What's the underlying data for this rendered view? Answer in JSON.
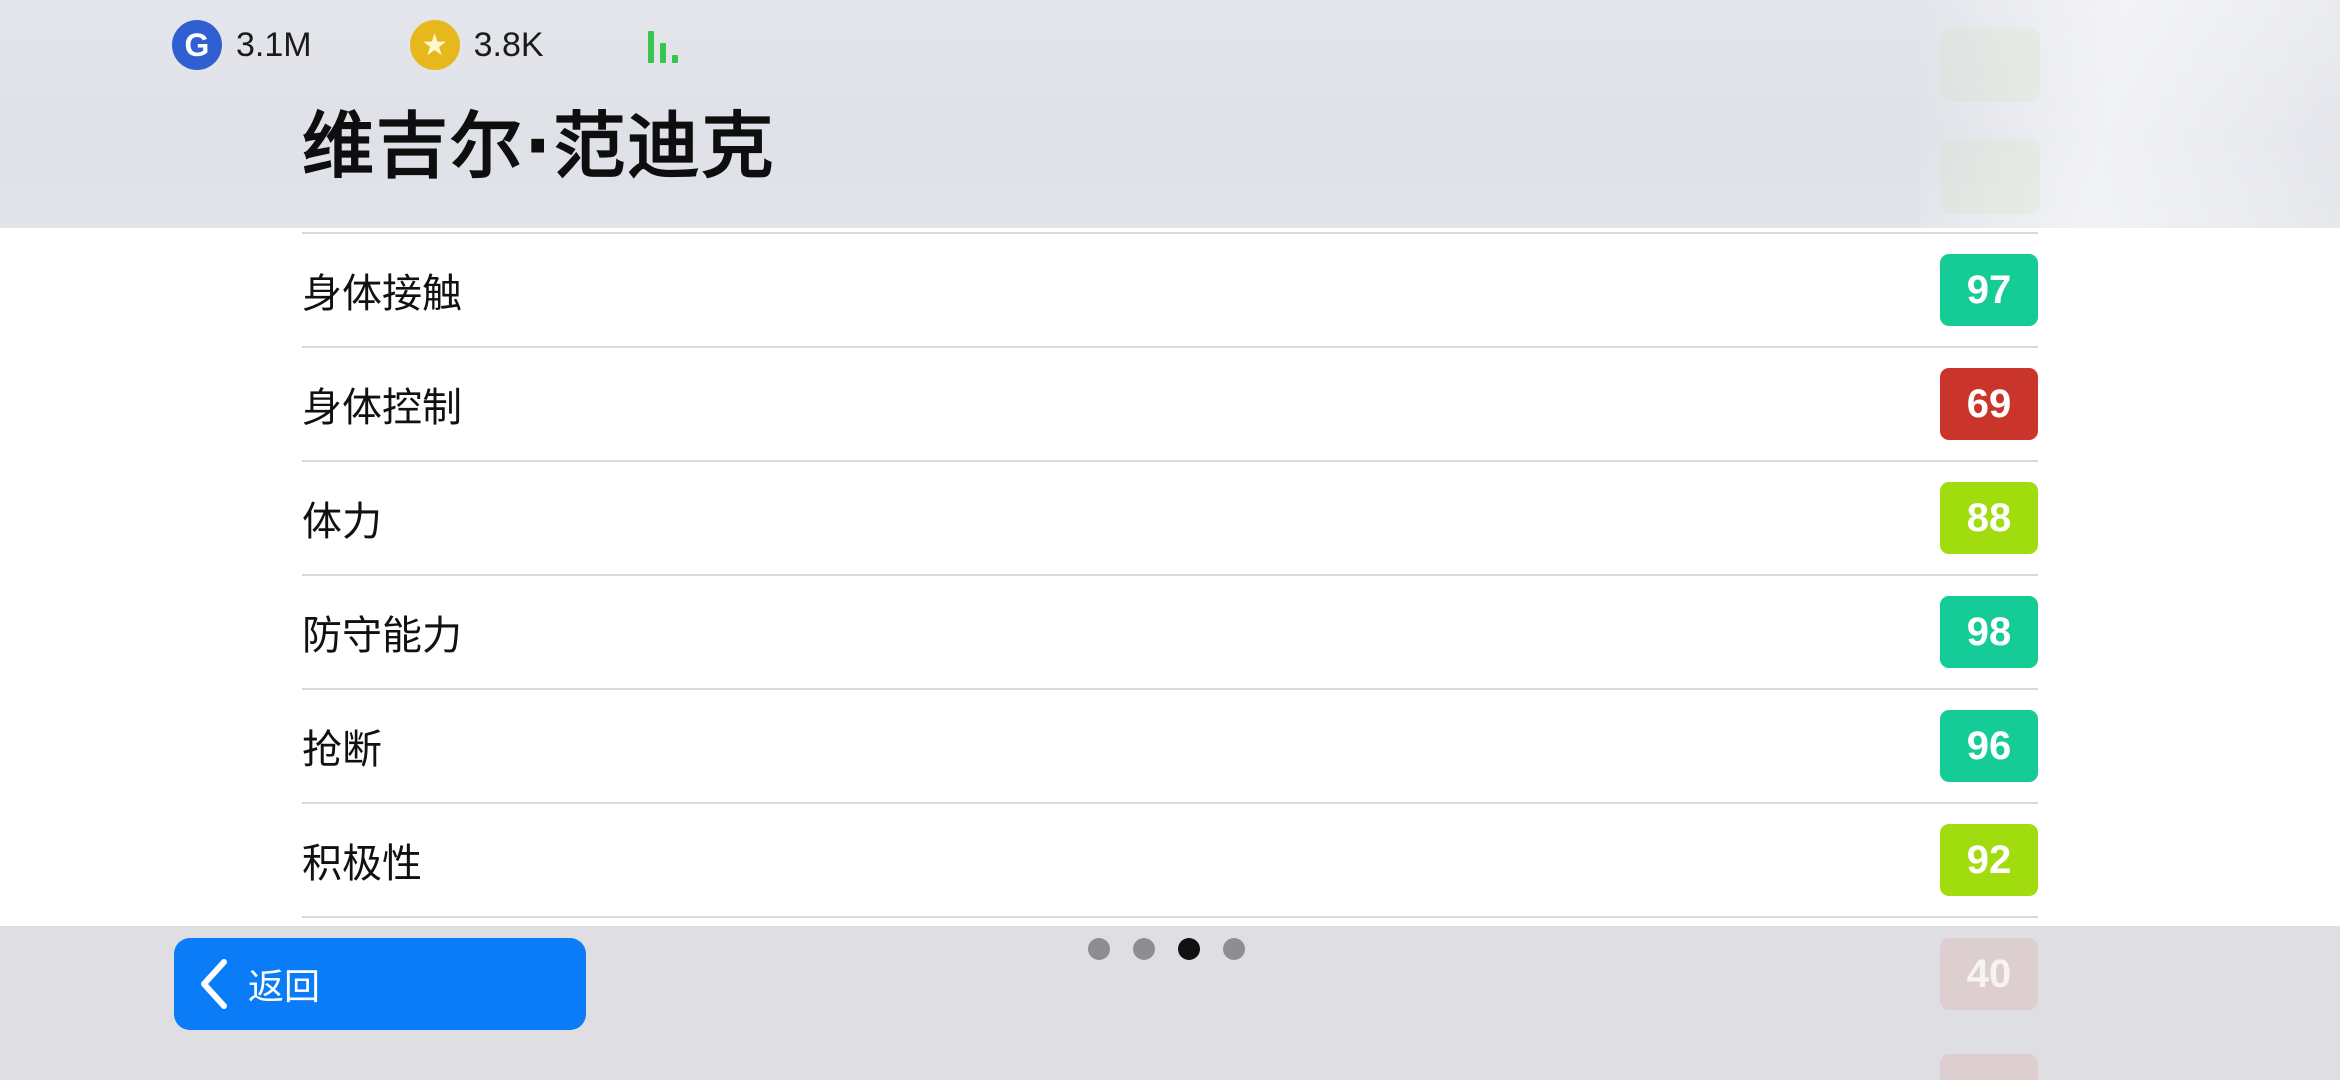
{
  "currencies": [
    {
      "icon": "g-coin-icon",
      "glyph": "G",
      "value": "3.1M"
    },
    {
      "icon": "star-coin-icon",
      "glyph": "★",
      "value": "3.8K"
    }
  ],
  "header": {
    "player_name": "维吉尔·范迪克"
  },
  "stats": [
    {
      "label": "身体接触",
      "value": "97",
      "color": "#16cc96"
    },
    {
      "label": "身体控制",
      "value": "69",
      "color": "#c9352a"
    },
    {
      "label": "体力",
      "value": "88",
      "color": "#a1dc0f"
    },
    {
      "label": "防守能力",
      "value": "98",
      "color": "#16cc96"
    },
    {
      "label": "抢断",
      "value": "96",
      "color": "#16cc96"
    },
    {
      "label": "积极性",
      "value": "92",
      "color": "#a1dc0f"
    }
  ],
  "partial_next_row": {
    "value": "40"
  },
  "footer": {
    "back_label": "返回",
    "page_count": 4,
    "active_page": 3
  },
  "colors": {
    "accent_blue": "#0a7cf7",
    "signal_green": "#37c54d"
  }
}
